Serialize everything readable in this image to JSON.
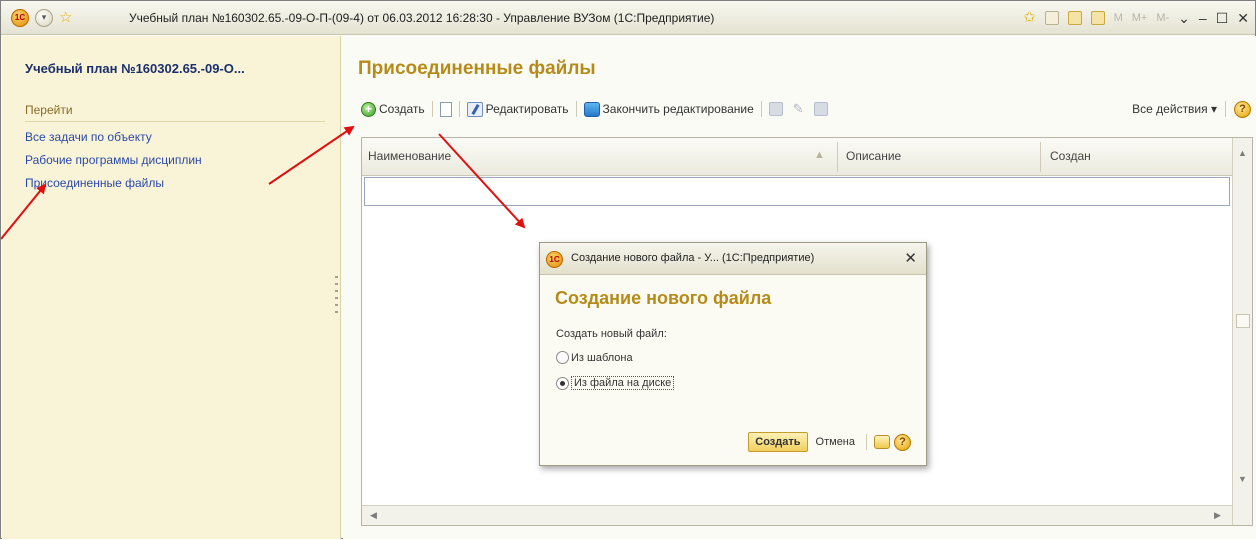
{
  "window": {
    "title": "Учебный план №160302.65.-09-О-П-(09-4) от 06.03.2012 16:28:30 - Управление ВУЗом  (1С:Предприятие)",
    "logo_text": "1С",
    "right_controls": [
      "M",
      "M+",
      "M-"
    ]
  },
  "sidebar": {
    "object_title": "Учебный план №160302.65.-09-О...",
    "section_label": "Перейти",
    "links": [
      "Все задачи по объекту",
      "Рабочие программы дисциплин",
      "Присоединенные файлы"
    ]
  },
  "main": {
    "title": "Присоединенные файлы",
    "toolbar": {
      "create": "Создать",
      "edit": "Редактировать",
      "finish_edit": "Закончить редактирование",
      "all_actions": "Все действия ▾",
      "help_glyph": "?"
    },
    "table": {
      "columns": [
        "Наименование",
        "Описание",
        "Создан"
      ]
    }
  },
  "dialog": {
    "window_title": "Создание нового файла - У...  (1С:Предприятие)",
    "heading": "Создание нового файла",
    "prompt": "Создать новый файл:",
    "options": [
      {
        "label": "Из шаблона",
        "selected": false
      },
      {
        "label": "Из файла на диске",
        "selected": true
      }
    ],
    "buttons": {
      "create": "Создать",
      "cancel": "Отмена",
      "help_glyph": "?"
    }
  },
  "colors": {
    "accent_gold": "#b58b1a",
    "sidebar_bg": "#f9f4d8",
    "link": "#2a4aa6",
    "arrow": "#e01010"
  },
  "icons": {
    "create": "plus-circle-icon",
    "copy": "document-icon",
    "edit": "edit-icon",
    "finish_edit": "finish-edit-icon",
    "help": "help-icon",
    "close": "close-icon"
  }
}
